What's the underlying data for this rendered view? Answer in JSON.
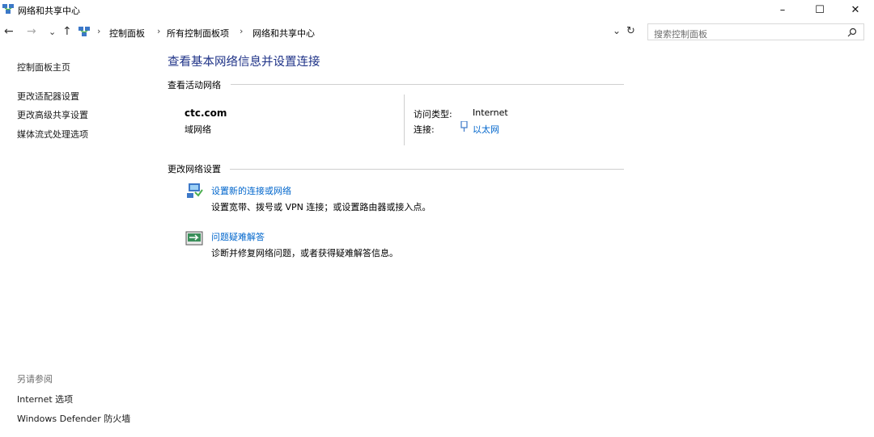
{
  "window": {
    "title": "网络和共享中心",
    "controls": {
      "minimize": "–",
      "maximize": "☐",
      "close": "✕"
    }
  },
  "address_bar": {
    "breadcrumbs": [
      "控制面板",
      "所有控制面板项",
      "网络和共享中心"
    ],
    "separator": "›",
    "dropdown_glyph": "⌄",
    "refresh_glyph": "↻"
  },
  "nav": {
    "back": "←",
    "forward": "→",
    "recent": "⌄",
    "up": "↑"
  },
  "search": {
    "placeholder": "搜索控制面板",
    "icon": "search-icon"
  },
  "sidebar": {
    "home": "控制面板主页",
    "items": [
      "更改适配器设置",
      "更改高级共享设置",
      "媒体流式处理选项"
    ],
    "see_also_heading": "另请参阅",
    "see_also": [
      "Internet 选项",
      "Windows Defender 防火墙"
    ]
  },
  "main": {
    "title": "查看基本网络信息并设置连接",
    "active_networks": {
      "heading": "查看活动网络",
      "network_name": "ctc.com",
      "network_category": "域网络",
      "access_type_label": "访问类型:",
      "access_type_value": "Internet",
      "connections_label": "连接:",
      "connections_value": "以太网"
    },
    "change_settings": {
      "heading": "更改网络设置",
      "tasks": [
        {
          "link": "设置新的连接或网络",
          "description": "设置宽带、拨号或 VPN 连接；或设置路由器或接入点。",
          "icon": "new-connection-icon"
        },
        {
          "link": "问题疑难解答",
          "description": "诊断并修复网络问题，或者获得疑难解答信息。",
          "icon": "troubleshoot-icon"
        }
      ]
    }
  },
  "colors": {
    "title_blue": "#1e3287",
    "link_blue": "#0066cc",
    "line_gray": "#cfcfcf"
  }
}
